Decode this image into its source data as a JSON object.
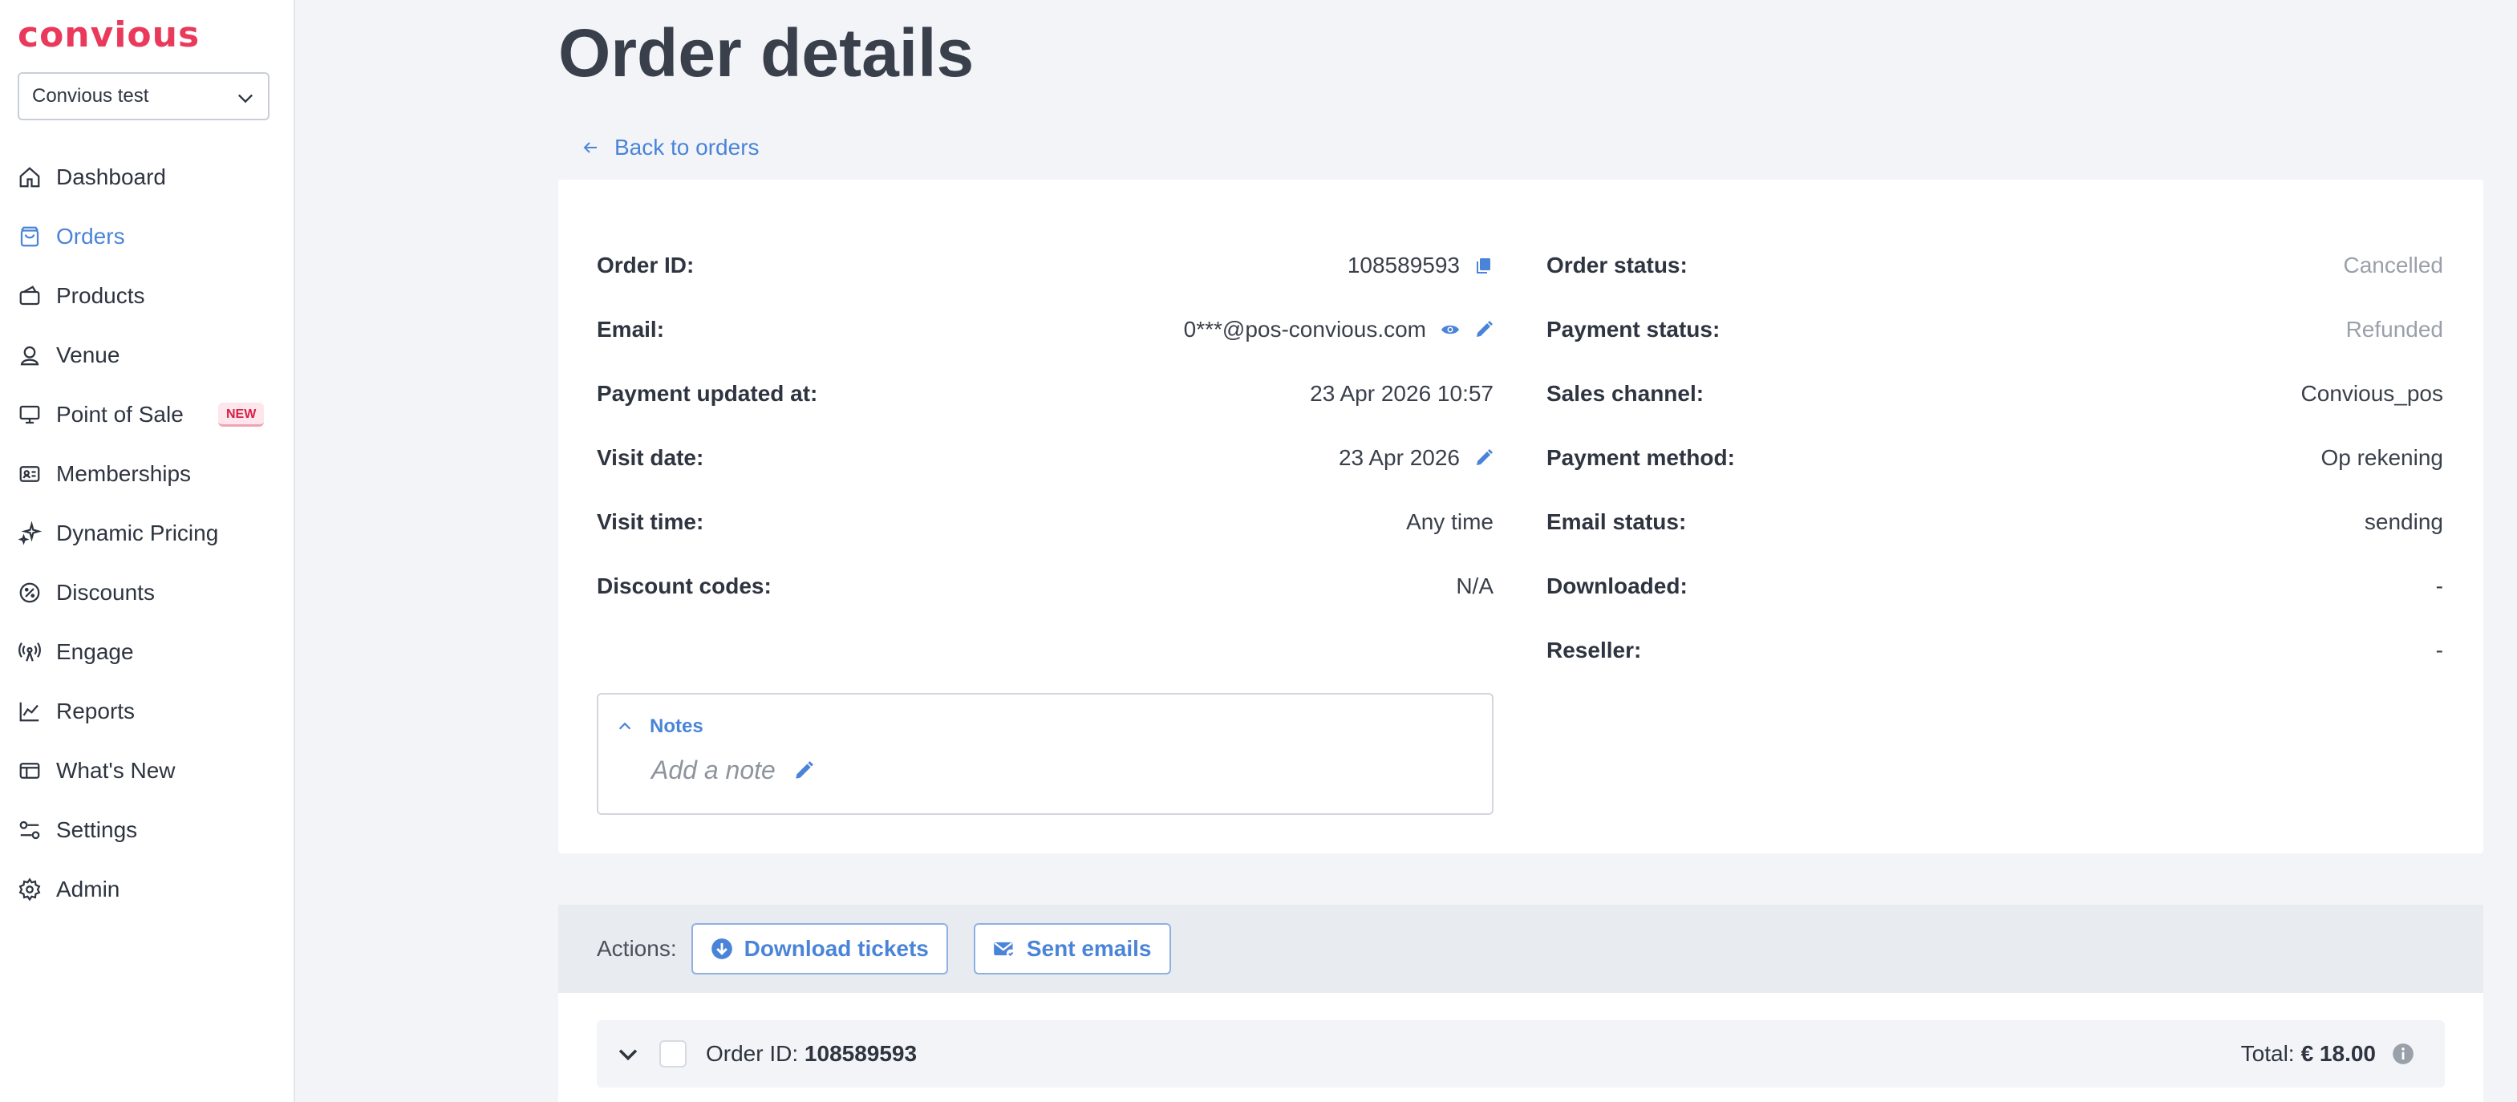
{
  "brand": {
    "logo_text": "convious",
    "accent": "#ea3a5c",
    "link": "#4a84d8"
  },
  "account_select": {
    "value": "Convious test"
  },
  "nav": {
    "items": [
      {
        "label": "Dashboard",
        "icon": "home-icon"
      },
      {
        "label": "Orders",
        "icon": "bag-icon",
        "active": true
      },
      {
        "label": "Products",
        "icon": "ticket-icon"
      },
      {
        "label": "Venue",
        "icon": "location-icon"
      },
      {
        "label": "Point of Sale",
        "icon": "monitor-icon",
        "badge": "NEW"
      },
      {
        "label": "Memberships",
        "icon": "id-card-icon"
      },
      {
        "label": "Dynamic Pricing",
        "icon": "sparkle-icon"
      },
      {
        "label": "Discounts",
        "icon": "discount-icon"
      },
      {
        "label": "Engage",
        "icon": "broadcast-icon"
      },
      {
        "label": "Reports",
        "icon": "chart-icon"
      },
      {
        "label": "What's New",
        "icon": "news-icon"
      },
      {
        "label": "Settings",
        "icon": "sliders-icon"
      },
      {
        "label": "Admin",
        "icon": "gear-icon"
      }
    ]
  },
  "page": {
    "title": "Order details",
    "back_label": "Back to orders"
  },
  "details": {
    "left": [
      {
        "label": "Order ID:",
        "value": "108589593"
      },
      {
        "label": "Email:",
        "value": "0***@pos-convious.com"
      },
      {
        "label": "Payment updated at:",
        "value": "23 Apr 2026 10:57"
      },
      {
        "label": "Visit date:",
        "value": "23 Apr 2026"
      },
      {
        "label": "Visit time:",
        "value": "Any time"
      },
      {
        "label": "Discount codes:",
        "value": "N/A"
      }
    ],
    "right": [
      {
        "label": "Order status:",
        "value": "Cancelled"
      },
      {
        "label": "Payment status:",
        "value": "Refunded"
      },
      {
        "label": "Sales channel:",
        "value": "Convious_pos"
      },
      {
        "label": "Payment method:",
        "value": "Op rekening"
      },
      {
        "label": "Email status:",
        "value": "sending"
      },
      {
        "label": "Downloaded:",
        "value": "-"
      },
      {
        "label": "Reseller:",
        "value": "-"
      }
    ]
  },
  "notes": {
    "title": "Notes",
    "placeholder": "Add a note"
  },
  "actions": {
    "label": "Actions:",
    "download_tickets": "Download tickets",
    "sent_emails": "Sent emails"
  },
  "order_summary": {
    "order_id_label": "Order ID:",
    "order_id": "108589593",
    "total_label": "Total:",
    "total_value": "€ 18.00"
  }
}
